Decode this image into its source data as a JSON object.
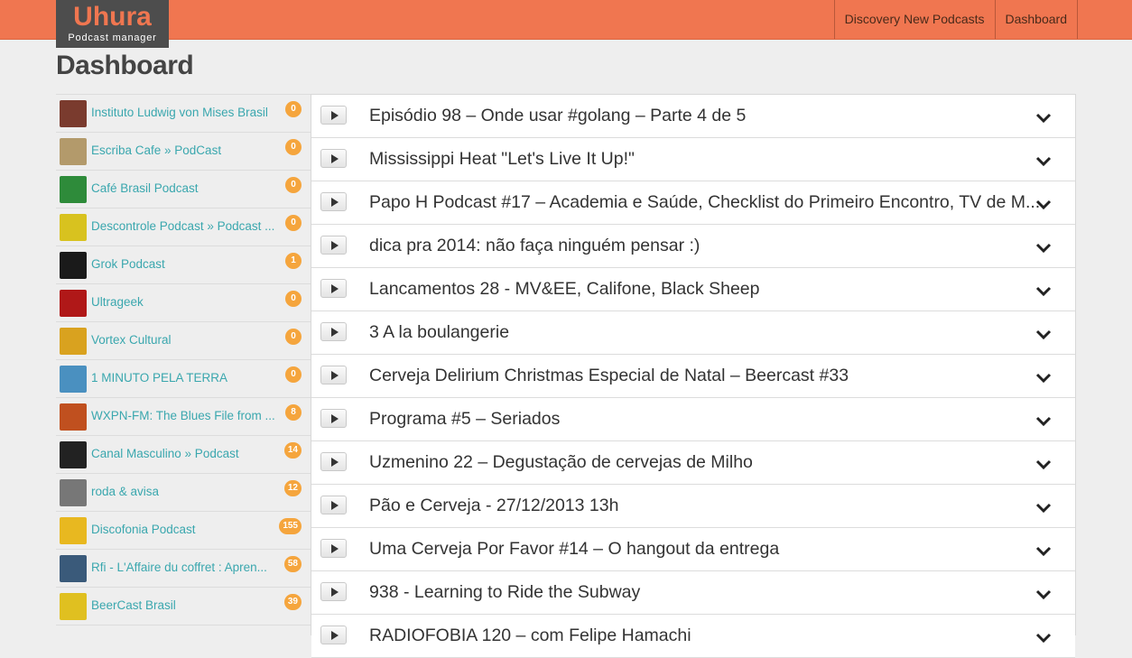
{
  "app": {
    "name": "Uhura",
    "subtitle": "Podcast manager"
  },
  "nav": {
    "items": [
      "Discovery New Podcasts",
      "Dashboard"
    ]
  },
  "page": {
    "title": "Dashboard"
  },
  "colors": {
    "accent": "#f07650",
    "badge": "#f5a53d",
    "link": "#3aa7ae"
  },
  "podcasts": [
    {
      "name": "Instituto Ludwig von Mises Brasil",
      "count": "0",
      "thumb": "#7a3b2e"
    },
    {
      "name": "Escriba Cafe » PodCast",
      "count": "0",
      "thumb": "#b39a6b"
    },
    {
      "name": "Café Brasil Podcast",
      "count": "0",
      "thumb": "#2e8b3a"
    },
    {
      "name": "Descontrole Podcast » Podcast ...",
      "count": "0",
      "thumb": "#d8c21f"
    },
    {
      "name": "Grok Podcast",
      "count": "1",
      "thumb": "#1a1a1a"
    },
    {
      "name": "Ultrageek",
      "count": "0",
      "thumb": "#b01818"
    },
    {
      "name": "Vortex Cultural",
      "count": "0",
      "thumb": "#d9a21f"
    },
    {
      "name": "1 MINUTO PELA TERRA",
      "count": "0",
      "thumb": "#4a90c0"
    },
    {
      "name": "WXPN-FM: The Blues File from ...",
      "count": "8",
      "thumb": "#c0501f"
    },
    {
      "name": "Canal Masculino » Podcast",
      "count": "14",
      "thumb": "#222222"
    },
    {
      "name": "roda & avisa",
      "count": "12",
      "thumb": "#777777"
    },
    {
      "name": "Discofonia Podcast",
      "count": "155",
      "thumb": "#e8b820"
    },
    {
      "name": "Rfi - L'Affaire du coffret : Apren...",
      "count": "58",
      "thumb": "#3a5a7a"
    },
    {
      "name": "BeerCast Brasil",
      "count": "39",
      "thumb": "#e0c020"
    }
  ],
  "episodes": [
    "Episódio 98 – Onde usar #golang – Parte 4 de 5",
    "Mississippi Heat \"Let's Live It Up!\"",
    "Papo H Podcast #17 – Academia e Saúde, Checklist do Primeiro Encontro, TV de M...",
    "dica pra 2014: não faça ninguém pensar :)",
    "Lancamentos 28 - MV&EE, Califone, Black Sheep",
    "3 A la boulangerie",
    "Cerveja Delirium Christmas Especial de Natal – Beercast #33",
    "Programa #5 – Seriados",
    "Uzmenino 22 – Degustação de cervejas de Milho",
    "Pão e Cerveja - 27/12/2013 13h",
    "Uma Cerveja Por Favor #14 – O hangout da entrega",
    "938 - Learning to Ride the Subway",
    "RADIOFOBIA 120 – com Felipe Hamachi"
  ]
}
